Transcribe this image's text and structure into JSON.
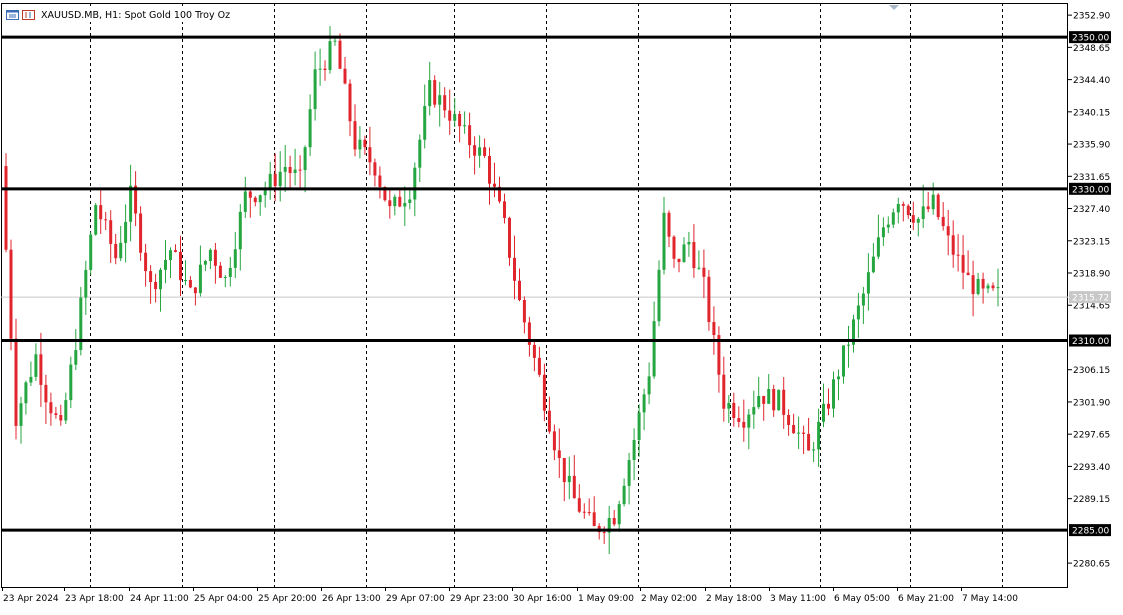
{
  "window": {
    "title": "XAUUSD.MB, H1:  Spot Gold 100 Troy Oz",
    "icons": [
      "chart-window-icon",
      "symbol-icon"
    ]
  },
  "colors": {
    "bullish": "#26a641",
    "bearish": "#e0252d",
    "level_line": "#000000",
    "grid": "#000000",
    "current_price_line": "#c8c8c8",
    "current_price_label_bg": "#c8c8c8"
  },
  "chart_data": {
    "type": "candlestick",
    "symbol": "XAUUSD.MB",
    "timeframe": "H1",
    "ylim": [
      2277.5,
      2354.5
    ],
    "y_ticks": [
      2352.9,
      2348.65,
      2344.4,
      2340.15,
      2335.9,
      2331.65,
      2327.4,
      2323.15,
      2318.9,
      2314.65,
      2306.15,
      2301.9,
      2297.65,
      2293.4,
      2289.15,
      2280.65
    ],
    "x_labels": [
      "23 Apr 2024",
      "23 Apr 18:00",
      "24 Apr 11:00",
      "25 Apr 04:00",
      "25 Apr 20:00",
      "26 Apr 13:00",
      "29 Apr 07:00",
      "29 Apr 23:00",
      "30 Apr 16:00",
      "1 May 09:00",
      "2 May 02:00",
      "2 May 18:00",
      "3 May 11:00",
      "6 May 05:00",
      "6 May 21:00",
      "7 May 14:00"
    ],
    "horizontal_levels": [
      2350.0,
      2330.0,
      2310.0,
      2285.0
    ],
    "current_price": 2315.72,
    "path_points": [
      [
        0,
        2333
      ],
      [
        3,
        2300
      ],
      [
        7,
        2308
      ],
      [
        9,
        2303
      ],
      [
        12,
        2298
      ],
      [
        15,
        2310
      ],
      [
        19,
        2328
      ],
      [
        23,
        2321
      ],
      [
        26,
        2329
      ],
      [
        30,
        2317
      ],
      [
        34,
        2322
      ],
      [
        38,
        2316
      ],
      [
        42,
        2322
      ],
      [
        45,
        2318
      ],
      [
        49,
        2329
      ],
      [
        53,
        2330
      ],
      [
        57,
        2333
      ],
      [
        60,
        2331
      ],
      [
        63,
        2345
      ],
      [
        67,
        2349
      ],
      [
        71,
        2336
      ],
      [
        75,
        2333
      ],
      [
        78,
        2327
      ],
      [
        82,
        2330
      ],
      [
        86,
        2343
      ],
      [
        89,
        2341
      ],
      [
        93,
        2337
      ],
      [
        97,
        2334
      ],
      [
        101,
        2325
      ],
      [
        104,
        2315
      ],
      [
        108,
        2305
      ],
      [
        112,
        2294
      ],
      [
        115,
        2289
      ],
      [
        119,
        2285
      ],
      [
        123,
        2287
      ],
      [
        127,
        2297
      ],
      [
        130,
        2306
      ],
      [
        133,
        2326
      ],
      [
        135,
        2320
      ],
      [
        138,
        2323
      ],
      [
        141,
        2317
      ],
      [
        145,
        2302
      ],
      [
        149,
        2300
      ],
      [
        152,
        2303
      ],
      [
        156,
        2302
      ],
      [
        159,
        2299
      ],
      [
        162,
        2295
      ],
      [
        166,
        2302
      ],
      [
        170,
        2310
      ],
      [
        173,
        2316
      ],
      [
        177,
        2325
      ],
      [
        180,
        2329
      ],
      [
        184,
        2326
      ],
      [
        187,
        2328
      ],
      [
        190,
        2323
      ],
      [
        194,
        2318
      ],
      [
        197,
        2316
      ],
      [
        200,
        2316
      ]
    ],
    "candle_count": 200
  }
}
